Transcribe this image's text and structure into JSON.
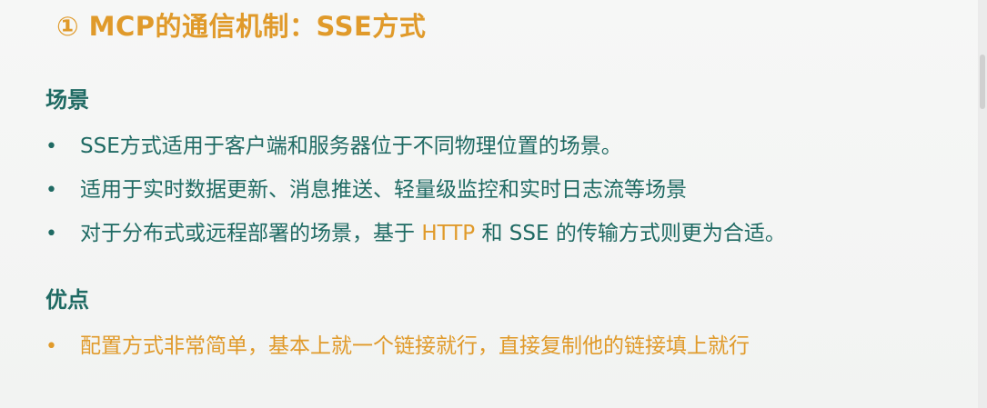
{
  "title": "① MCP的通信机制：SSE方式",
  "sections": [
    {
      "heading": "场景",
      "bullets": [
        {
          "text": "SSE方式适用于客户端和服务器位于不同物理位置的场景。"
        },
        {
          "text": "适用于实时数据更新、消息推送、轻量级监控和实时日志流等场景"
        },
        {
          "pre": "对于分布式或远程部署的场景，基于 ",
          "accent": "HTTP",
          "post": " 和 SSE 的传输方式则更为合适。"
        }
      ]
    },
    {
      "heading": "优点",
      "bullets": [
        {
          "text": "配置方式非常简单，基本上就一个链接就行，直接复制他的链接填上就行"
        }
      ]
    }
  ],
  "colors": {
    "accent": "#e09a2a",
    "text": "#1f6a63",
    "background": "#f4f5f4"
  },
  "icons": {
    "bullet": "•",
    "text_cursor": "i-beam-cursor-icon"
  }
}
